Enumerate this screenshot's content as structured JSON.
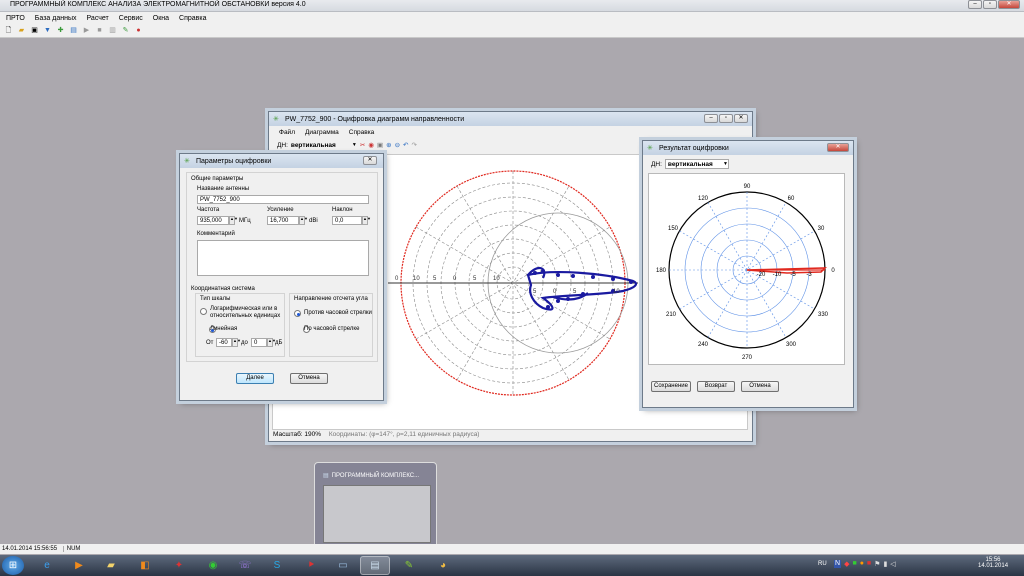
{
  "app": {
    "title": "ПРОГРАММНЫЙ КОМПЛЕКС АНАЛИЗА ЭЛЕКТРОМАГНИТНОЙ ОБСТАНОВКИ версия 4.0",
    "menu": [
      "ПРТО",
      "База данных",
      "Расчет",
      "Сервис",
      "Окна",
      "Справка"
    ],
    "status": "14.01.2014 15:56:55",
    "status_num": "NUM"
  },
  "digitizer": {
    "title": "PW_7752_900 - Оцифровка диаграмм направленности",
    "menu": [
      "Файл",
      "Диаграмма",
      "Справка"
    ],
    "dn_label": "ДН:",
    "dn_value": "вертикальная",
    "scale": "Масштаб: 190%",
    "coords": "Координаты: (φ=147°, ρ=2,11 единичных радиуса)",
    "axis_labels": [
      "0",
      "10",
      "5",
      "0",
      "5",
      "10",
      "5",
      "0",
      "5",
      "10"
    ]
  },
  "params": {
    "title": "Параметры оцифровки",
    "general": "Общие параметры",
    "antenna_name_label": "Название антенны",
    "antenna_name": "PW_7752_900",
    "freq_label": "Частота",
    "freq": "935,000",
    "freq_unit": "МГц",
    "gain_label": "Усиление",
    "gain": "16,700",
    "gain_unit": "dBi",
    "tilt_label": "Наклон",
    "tilt": "0,0",
    "comment_label": "Комментарий",
    "coord_system": "Координатная система",
    "scale_type": "Тип шкалы",
    "opt_log": "Логарифмическая или в относительных единицах",
    "opt_linear": "Линейная",
    "from_label": "От",
    "from_val": "-60",
    "to_label": "до",
    "to_val": "0",
    "db": "дБ",
    "direction": "Направление отсчета угла",
    "ccw": "Против часовой стрелки",
    "cw": "По часовой стрелке",
    "next": "Далее",
    "cancel": "Отмена"
  },
  "result": {
    "title": "Результат оцифровки",
    "dn_label": "ДН:",
    "dn_value": "вертикальная",
    "angles": [
      "90",
      "60",
      "30",
      "0",
      "330",
      "300",
      "270",
      "240",
      "210",
      "180",
      "150",
      "120"
    ],
    "radial": [
      "-20",
      "-10",
      "-5",
      "-3"
    ],
    "save": "Сохранение",
    "back": "Возврат",
    "cancel": "Отмена"
  },
  "thumb": {
    "title": "ПРОГРАММНЫЙ КОМПЛЕКС..."
  },
  "taskbar": {
    "lang": "RU",
    "time": "15:56",
    "date": "14.01.2014"
  },
  "colors": {
    "pattern": "#1a1aa0",
    "accent_red": "#e0281e",
    "grid_blue": "#5b8fe6"
  }
}
